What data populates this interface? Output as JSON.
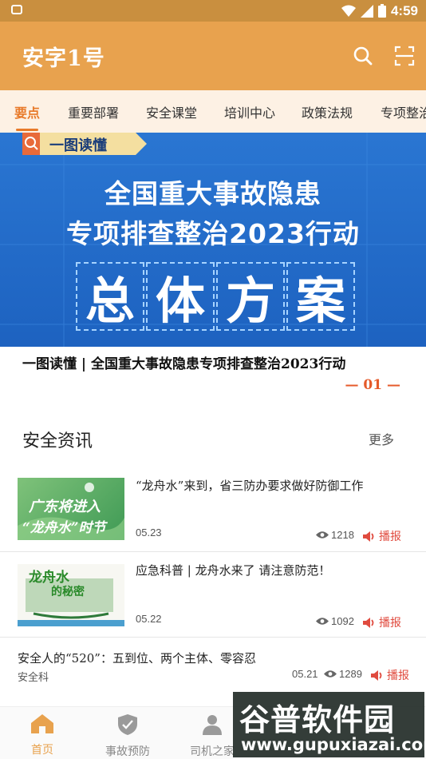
{
  "status_bar": {
    "time": "4:59"
  },
  "app": {
    "title": "安字1号"
  },
  "colors": {
    "primary": "#e8a24e",
    "accent": "#e87a2a",
    "play": "#e04b3f",
    "banner": "#2a76d2"
  },
  "tabs": [
    {
      "label": "要点",
      "active": true
    },
    {
      "label": "重要部署"
    },
    {
      "label": "安全课堂"
    },
    {
      "label": "培训中心"
    },
    {
      "label": "政策法规"
    },
    {
      "label": "专项整治"
    }
  ],
  "banner": {
    "tag": "一图读懂",
    "line1": "全国重大事故隐患",
    "line2": "专项排查整治2023行动",
    "big": [
      "总",
      "体",
      "方",
      "案"
    ]
  },
  "carousel": {
    "caption": "一图读懂 | 全国重大事故隐患专项排查整治2023行动",
    "page": "01"
  },
  "section": {
    "title": "安全资讯",
    "more": "更多"
  },
  "news": [
    {
      "title": "“龙舟水”来到，省三防办要求做好防御工作",
      "date": "05.23",
      "views": "1218",
      "play": "播报",
      "thumb_text1": "广东将进入",
      "thumb_text2": "“龙舟水”时节"
    },
    {
      "title": "应急科普 | 龙舟水来了 请注意防范！",
      "date": "05.22",
      "views": "1092",
      "play": "播报",
      "thumb_text1": "龙舟水",
      "thumb_text2": "的秘密"
    },
    {
      "title": "安全人的“520”：五到位、两个主体、零容忍",
      "source": "安全科",
      "date": "05.21",
      "views": "1289",
      "play": "播报"
    }
  ],
  "bottom_nav": [
    {
      "label": "首页",
      "icon": "home-icon",
      "active": true
    },
    {
      "label": "事故预防",
      "icon": "shield-check-icon"
    },
    {
      "label": "司机之家",
      "icon": "person-icon"
    }
  ],
  "watermark": {
    "top": "谷普软件园",
    "bottom": "www.gupuxiazai.com"
  }
}
